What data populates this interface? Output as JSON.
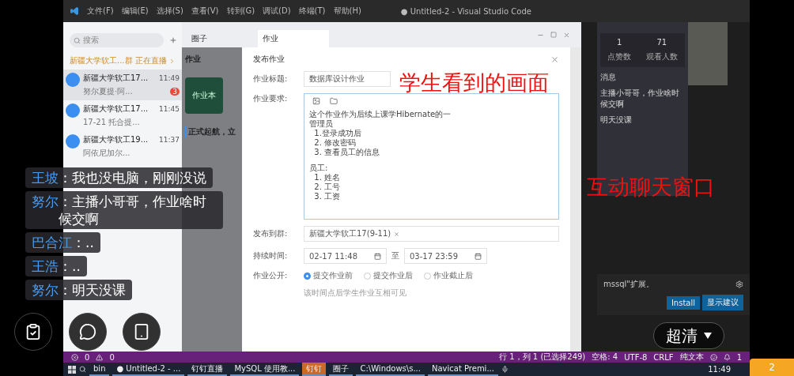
{
  "editor": {
    "menu": [
      "文件(F)",
      "编辑(E)",
      "选择(S)",
      "查看(V)",
      "转到(G)",
      "调试(D)",
      "终端(T)",
      "帮助(H)"
    ],
    "title": "● Untitled-2 - Visual Studio Code"
  },
  "chat_list": {
    "search_placeholder": "搜索",
    "live_banner": "新疆大学软工...群 正在直播",
    "conversations": [
      {
        "name": "新疆大学软工17...",
        "time": "11:49",
        "preview": "努尔夏提·阿...",
        "unread": "3",
        "selected": true
      },
      {
        "name": "新疆大学软工17...",
        "time": "11:45",
        "preview": "17-21 托合提...",
        "selected": false
      },
      {
        "name": "新疆大学软工19...",
        "time": "11:37",
        "preview": "阿依尼加尔...",
        "selected": false
      }
    ]
  },
  "homework": {
    "tabs": [
      {
        "label": "圈子",
        "selected": false
      },
      {
        "label": "作业",
        "selected": true
      }
    ],
    "side_title": "作业",
    "side_card": "作业本",
    "notice": "正式起航，立",
    "dialog_title": "发布作业",
    "title_field": {
      "label": "作业标题:",
      "value": "数据库设计作业"
    },
    "requirement": {
      "label": "作业要求:",
      "paragraphs": [
        [
          "这个作业作为后续上课学Hibernate的一",
          "管理员",
          "  1.登录成功后",
          "  2. 修改密码",
          "  3. 查看员工的信息"
        ],
        [
          "员工:",
          "  1. 姓名",
          "  2. 工号",
          "  3. 工资"
        ]
      ]
    },
    "group": {
      "label": "发布到群:",
      "tag": "新疆大学软工17(9-11)"
    },
    "duration": {
      "label": "持续时间:",
      "start": "02-17 11:48",
      "separator": "至",
      "end": "03-17 23:59"
    },
    "visibility": {
      "label": "作业公开:",
      "options": [
        {
          "label": "提交作业前",
          "selected": true
        },
        {
          "label": "提交作业后",
          "selected": false
        },
        {
          "label": "作业截止后",
          "selected": false
        }
      ],
      "hint": "该时间点后学生作业互相可见"
    }
  },
  "live_panel": {
    "stats": [
      {
        "value": "1",
        "label": "点赞数"
      },
      {
        "value": "71",
        "label": "观看人数"
      }
    ],
    "section": "消息",
    "messages": [
      {
        "text": "主播小哥哥，作业啥时候交啊"
      },
      {
        "text": "明天没课"
      }
    ]
  },
  "notification": {
    "text": "mssql\"扩展。",
    "buttons": [
      "Install",
      "显示建议"
    ]
  },
  "status_bar": {
    "errors": "0",
    "warnings": "0",
    "items": [
      "行 1，列 1 (已选择249)",
      "空格: 4",
      "UTF-8",
      "CRLF",
      "纯文本"
    ],
    "bell": "1"
  },
  "taskbar": {
    "items": [
      {
        "label": "bin",
        "selected": false
      },
      {
        "label": "● Untitled-2 - ...",
        "selected": false
      },
      {
        "label": "钉钉直播",
        "selected": false
      },
      {
        "label": "MySQL 使用教...",
        "selected": false
      },
      {
        "label": "钉钉",
        "selected": true
      },
      {
        "label": "圈子",
        "selected": false
      },
      {
        "label": "C:\\Windows\\s...",
        "selected": false
      },
      {
        "label": "Navicat Premi...",
        "selected": false
      }
    ],
    "time": "11:49"
  },
  "comments": [
    {
      "user": "王坡",
      "text": "：我也没电脑，刚刚没说"
    },
    {
      "user": "努尔",
      "text": "：主播小哥哥，作业啥时候交啊"
    },
    {
      "user": "巴合江",
      "text": "：.."
    },
    {
      "user": "王浩",
      "text": "：.."
    },
    {
      "user": "努尔",
      "text": "：明天没课"
    }
  ],
  "annotations": [
    "学生看到的画面",
    "互动聊天窗口"
  ],
  "quality": "超清",
  "page_badge": "2"
}
